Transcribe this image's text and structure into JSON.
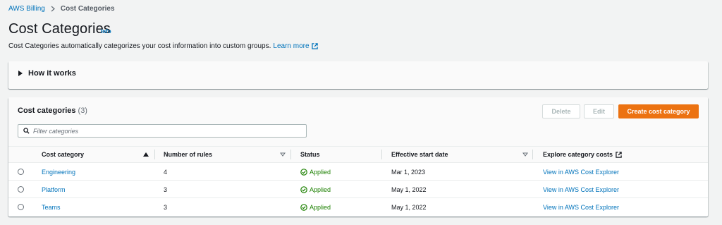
{
  "breadcrumb": {
    "parent": "AWS Billing",
    "current": "Cost Categories"
  },
  "header": {
    "title": "Cost Categories",
    "info": "Info",
    "description": "Cost Categories automatically categorizes your cost information into custom groups.",
    "learn_more": "Learn more"
  },
  "how_it_works": {
    "title": "How it works"
  },
  "table": {
    "title": "Cost categories",
    "count": "(3)",
    "buttons": {
      "delete": "Delete",
      "edit": "Edit",
      "create": "Create cost category"
    },
    "search_placeholder": "Filter categories",
    "columns": {
      "cost_category": "Cost category",
      "number_of_rules": "Number of rules",
      "status": "Status",
      "effective_start_date": "Effective start date",
      "explore": "Explore category costs"
    },
    "rows": [
      {
        "name": "Engineering",
        "rules": "4",
        "status": "Applied",
        "start_date": "Mar 1, 2023",
        "explore": "View in AWS Cost Explorer"
      },
      {
        "name": "Platform",
        "rules": "3",
        "status": "Applied",
        "start_date": "May 1, 2022",
        "explore": "View in AWS Cost Explorer"
      },
      {
        "name": "Teams",
        "rules": "3",
        "status": "Applied",
        "start_date": "May 1, 2022",
        "explore": "View in AWS Cost Explorer"
      }
    ]
  },
  "colors": {
    "link": "#0073bb",
    "primary_button": "#ec7211",
    "success": "#1d8102",
    "background": "#f2f3f3"
  },
  "icons": {
    "breadcrumb_separator": "chevron-right-icon",
    "external": "external-link-icon",
    "expand": "caret-right-icon",
    "search": "search-icon",
    "sort_asc": "sort-ascending-icon",
    "sort": "sort-icon",
    "status_ok": "check-circle-icon"
  }
}
